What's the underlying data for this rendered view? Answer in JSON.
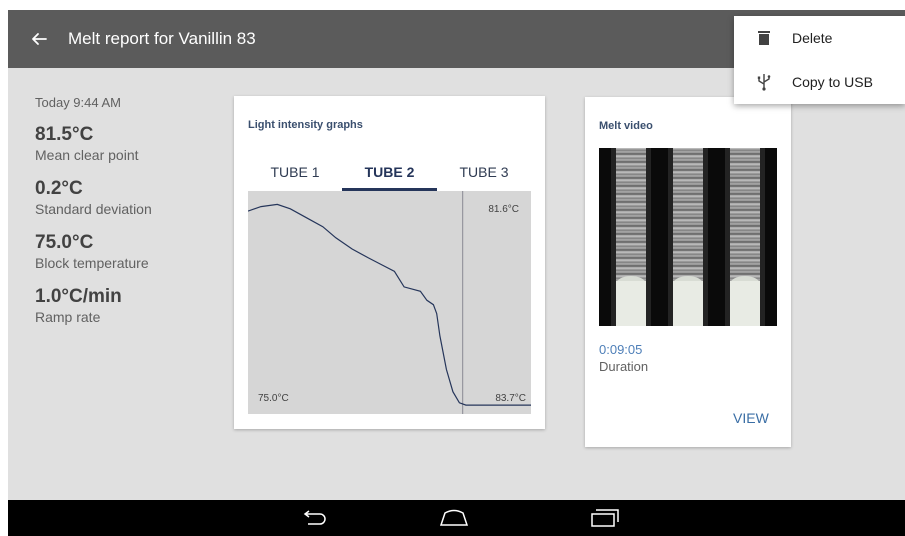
{
  "appbar": {
    "title": "Melt report for Vanillin 83"
  },
  "menu": {
    "items": [
      {
        "label": "Delete",
        "icon": "trash-icon"
      },
      {
        "label": "Copy to USB",
        "icon": "usb-icon"
      }
    ]
  },
  "stats": {
    "timestamp": "Today 9:44 AM",
    "items": [
      {
        "value": "81.5°C",
        "label": "Mean clear point"
      },
      {
        "value": "0.2°C",
        "label": "Standard deviation"
      },
      {
        "value": "75.0°C",
        "label": "Block temperature"
      },
      {
        "value": "1.0°C/min",
        "label": "Ramp rate"
      }
    ]
  },
  "graph_card": {
    "title": "Light intensity graphs",
    "tabs": [
      "TUBE 1",
      "TUBE 2",
      "TUBE 3"
    ],
    "active_tab": 1,
    "marker_label": "81.6°C",
    "x_start_label": "75.0°C",
    "x_end_label": "83.7°C"
  },
  "chart_data": {
    "type": "line",
    "xlim": [
      75.0,
      83.7
    ],
    "marker_x": 81.6,
    "series": [
      {
        "x": [
          75.0,
          75.4,
          75.9,
          76.3,
          76.8,
          77.3,
          77.7,
          78.2,
          78.7,
          79.1,
          79.5,
          79.8,
          80.3,
          80.5,
          80.7,
          80.8,
          80.9,
          81.1,
          81.3,
          81.5,
          81.7,
          82.2,
          82.7,
          83.2,
          83.7
        ],
        "y": [
          0.91,
          0.93,
          0.94,
          0.92,
          0.88,
          0.84,
          0.79,
          0.74,
          0.7,
          0.67,
          0.64,
          0.57,
          0.55,
          0.51,
          0.49,
          0.45,
          0.35,
          0.2,
          0.1,
          0.05,
          0.04,
          0.04,
          0.04,
          0.04,
          0.04
        ]
      }
    ]
  },
  "video_card": {
    "title": "Melt video",
    "duration_value": "0:09:05",
    "duration_label": "Duration",
    "view_label": "VIEW"
  },
  "colors": {
    "appbar": "#5b5b5b",
    "background": "#e0e0e0",
    "accent_link": "#3a6ea5",
    "graph_line": "#25355a"
  }
}
